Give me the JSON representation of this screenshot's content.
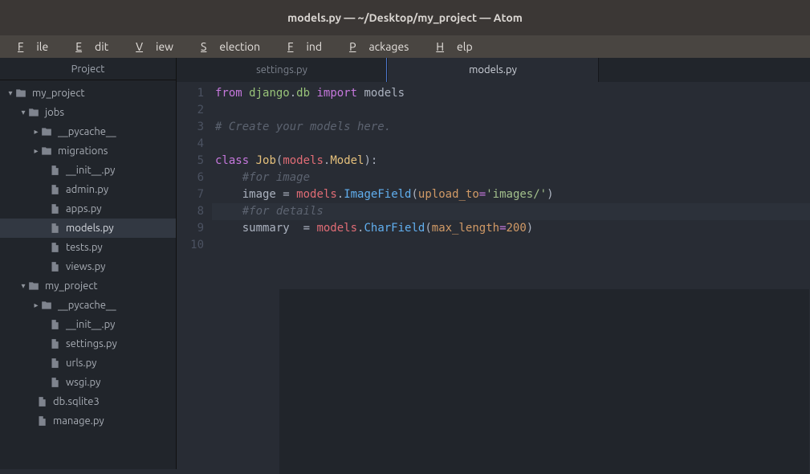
{
  "titlebar": "models.py — ~/Desktop/my_project — Atom",
  "menu": {
    "file": "ile",
    "edit": "dit",
    "view": "iew",
    "selection": "election",
    "find": "ind",
    "packages": "ackages",
    "help": "elp"
  },
  "project_header": "Project",
  "tree": {
    "root": "my_project",
    "jobs": "jobs",
    "pyc1": "__pycache__",
    "migrations": "migrations",
    "init1": "__init__.py",
    "admin": "admin.py",
    "apps": "apps.py",
    "models": "models.py",
    "tests": "tests.py",
    "views": "views.py",
    "myproj2": "my_project",
    "pyc2": "__pycache__",
    "init2": "__init__.py",
    "settings": "settings.py",
    "urls": "urls.py",
    "wsgi": "wsgi.py",
    "db": "db.sqlite3",
    "manage": "manage.py"
  },
  "tabs": {
    "t1": "settings.py",
    "t2": "models.py"
  },
  "gutter": [
    "1",
    "2",
    "3",
    "4",
    "5",
    "6",
    "7",
    "8",
    "9",
    "10"
  ],
  "code": {
    "l1_from": "from",
    "l1_mod": "django",
    "l1_dot1": ".",
    "l1_db": "db",
    "l1_import": "import",
    "l1_models": "models",
    "l3": "# Create your models here.",
    "l5_class": "class",
    "l5_name": "Job",
    "l5_open": "(",
    "l5_models": "models",
    "l5_dot": ".",
    "l5_Model": "Model",
    "l5_close": "):",
    "l6": "#for image",
    "l7_img": "image",
    "l7_eq": " = ",
    "l7_models": "models",
    "l7_dot": ".",
    "l7_IF": "ImageField",
    "l7_open": "(",
    "l7_arg": "upload_to",
    "l7_eq2": "=",
    "l7_sq": "'",
    "l7_str": "images/",
    "l7_close": "')",
    "l8": "#for details",
    "l9_sum": "summary",
    "l9_eq": "  = ",
    "l9_models": "models",
    "l9_dot": ".",
    "l9_CF": "CharField",
    "l9_open": "(",
    "l9_arg": "max_length",
    "l9_eq2": "=",
    "l9_num": "200",
    "l9_close": ")"
  }
}
